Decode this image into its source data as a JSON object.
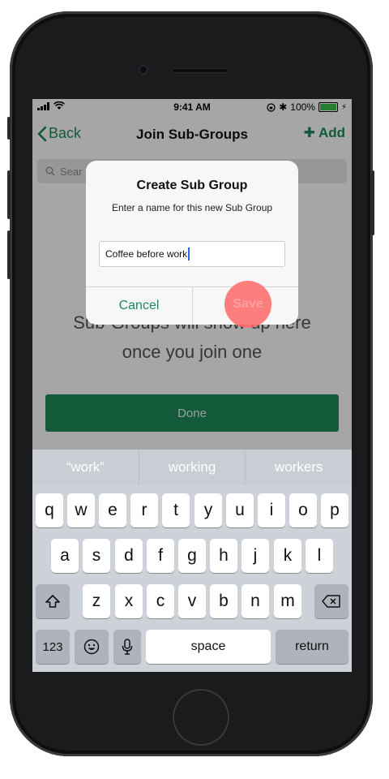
{
  "status_bar": {
    "time": "9:41 AM",
    "battery": "100%"
  },
  "nav": {
    "back_label": "Back",
    "title": "Join Sub-Groups",
    "add_label": "Add"
  },
  "search": {
    "placeholder": "Sear"
  },
  "content": {
    "empty_line1": "Sub-Groups will show up here",
    "empty_line2": "once you join one",
    "done_label": "Done"
  },
  "dialog": {
    "title": "Create Sub Group",
    "message": "Enter a name for this new Sub Group",
    "input_value": "Coffee before work",
    "cancel_label": "Cancel",
    "save_label": "Save"
  },
  "keyboard": {
    "suggestions": [
      "“work”",
      "working",
      "workers"
    ],
    "row1": [
      "q",
      "w",
      "e",
      "r",
      "t",
      "y",
      "u",
      "i",
      "o",
      "p"
    ],
    "row2": [
      "a",
      "s",
      "d",
      "f",
      "g",
      "h",
      "j",
      "k",
      "l"
    ],
    "row3": [
      "z",
      "x",
      "c",
      "v",
      "b",
      "n",
      "m"
    ],
    "numbers_label": "123",
    "space_label": "space",
    "return_label": "return"
  },
  "colors": {
    "accent": "#1e8a5a",
    "touch_indicator": "#ff6969"
  }
}
